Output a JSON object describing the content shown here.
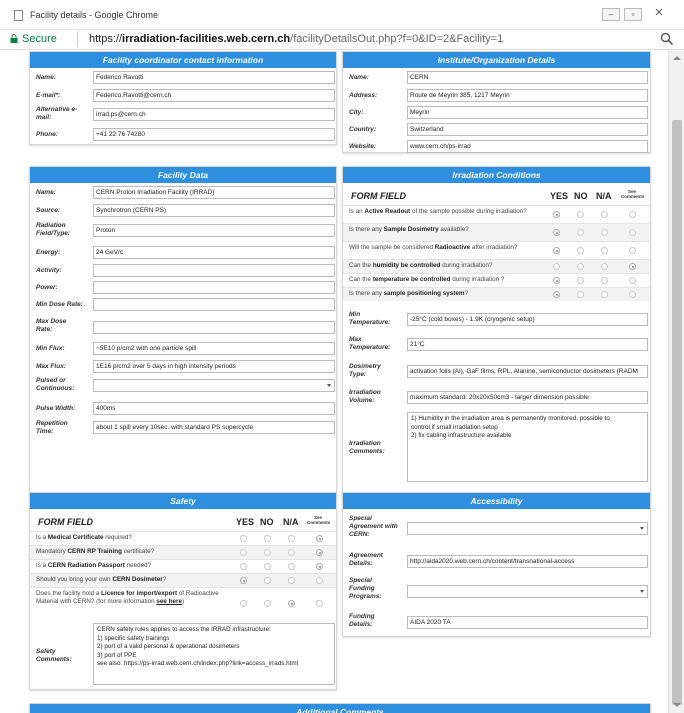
{
  "window": {
    "title": "Facility details - Google Chrome"
  },
  "address": {
    "secure_label": "Secure",
    "url_scheme": "https://",
    "url_domain": "irradiation-facilities.web.cern.ch",
    "url_path": "/facilityDetailsOut.php?f=0&ID=2&Facility=1"
  },
  "coordinator": {
    "title": "Facility coordinator contact information",
    "fields": [
      {
        "label": "Name:",
        "value": "Federico Ravotti"
      },
      {
        "label": "E-mail*:",
        "value": "Federico.Ravotti@cern.ch"
      },
      {
        "label": "Alternative e-mail:",
        "value": "irrad.ps@cern.ch"
      },
      {
        "label": "Phone:",
        "value": "+41 22 76 74280"
      }
    ]
  },
  "institute": {
    "title": "Institute/Organization Details",
    "fields": [
      {
        "label": "Name:",
        "value": "CERN"
      },
      {
        "label": "Address:",
        "value": "Route de Meyrin 385, 1217 Meyrin"
      },
      {
        "label": "City:",
        "value": "Meyrin"
      },
      {
        "label": "Country:",
        "value": "Switzerland"
      },
      {
        "label": "Website:",
        "value": "www.cern.ch/ps-irrad"
      }
    ]
  },
  "facility": {
    "title": "Facility Data",
    "fields": [
      {
        "label": "Name:",
        "value": "CERN Proton Irradiation Facility (IRRAD)"
      },
      {
        "label": "Source:",
        "value": "Synchrotron (CERN PS)"
      },
      {
        "label": "Radiation Field/Type:",
        "value": "Proton"
      },
      {
        "label": "Energy:",
        "value": "24 GeV/c"
      },
      {
        "label": "Activity:",
        "value": ""
      },
      {
        "label": "Power:",
        "value": ""
      },
      {
        "label": "Min Dose Rate:",
        "value": ""
      },
      {
        "label": "Max Dose Rate:",
        "value": ""
      },
      {
        "label": "Min Flux:",
        "value": "~5E10 p/cm2 with one particle spill"
      },
      {
        "label": "Max Flux:",
        "value": "1E16 p/cm2 over 5 days in high intensity periods"
      },
      {
        "label": "Pulsed or Continuous:",
        "value": ""
      },
      {
        "label": "Pulse Width:",
        "value": "400ms"
      },
      {
        "label": "Repetition Time:",
        "value": "about 1 spill every 10sec. with standard PS supercycle"
      }
    ]
  },
  "irradiation": {
    "title": "Irradiation Conditions",
    "form_field": "FORM FIELD",
    "col_yes": "YES",
    "col_no": "NO",
    "col_na": "N/A",
    "col_see": "See Comments",
    "questions": [
      {
        "pre": "Is an ",
        "bold": "Active Readout",
        "post": " of the sample possible during irradiation?",
        "sel": 0
      },
      {
        "pre": "Is there any ",
        "bold": "Sample Dosimetry",
        "post": " available?",
        "sel": 0
      },
      {
        "pre": "Will the sample be considered ",
        "bold": "Radioactive",
        "post": " after irradiation?",
        "sel": 0
      },
      {
        "pre": "Can the ",
        "bold": "humidity be controlled",
        "post": " during irradiation?",
        "sel": 3
      },
      {
        "pre": "Can the ",
        "bold": "temperature be controlled",
        "post": " during irradiation ?",
        "sel": 0
      },
      {
        "pre": "Is there any ",
        "bold": "sample positioning system",
        "post": "?",
        "sel": 0
      }
    ],
    "fields": [
      {
        "label": "Min Temperature:",
        "value": "-25°C (cold boxes) - 1.9K (cryogenic setup)"
      },
      {
        "label": "Max Temperature:",
        "value": "21°C"
      },
      {
        "label": "Dosimetry Type:",
        "value": "activation foils (Al), GaF films, RPL, Alanine, semiconductor dosimeters (RADM"
      },
      {
        "label": "Irradiation Volume:",
        "value": "maximum standard: 20x20x50cm3 - larger dimension possible"
      }
    ],
    "comments_label": "Irradiation Comments:",
    "comments": [
      "1) Humidity in the irradiation area is permanently monitored, possible to",
      "control if small irradiation setup",
      "2) fix cabling infrastructure available"
    ]
  },
  "safety": {
    "title": "Safety",
    "form_field": "FORM FIELD",
    "col_yes": "YES",
    "col_no": "NO",
    "col_na": "N/A",
    "col_see": "See Comments",
    "questions": [
      {
        "pre": "Is a ",
        "bold": "Medical Certificate",
        "post": " required?",
        "sel": 3
      },
      {
        "pre": "Mandatory ",
        "bold": "CERN RP Training",
        "post": " certificate?",
        "sel": 3
      },
      {
        "pre": "Is a ",
        "bold": "CERN Radiation Passport",
        "post": " needed?",
        "sel": 3
      },
      {
        "pre": "Should you bring your own ",
        "bold": "CERN Dosimeter",
        "post": "?",
        "sel": 0
      },
      {
        "pre": "Does the facility hold a ",
        "bold": "Licence for import/export",
        "post": " of Radioactive Material with CERN? (for more information ",
        "link": "see here",
        "tail": ")",
        "sel": 2
      }
    ],
    "comments_label": "Safety Comments:",
    "comments": [
      "CERN safety rules applies to access the IRRAD infrastructure:",
      "1) specific safety trainings",
      "2) port of a valid personal & operational dosimeters",
      "3) port of PPE",
      "see also:  https://ps-irrad.web.cern.ch/index.php?link=access_irrads.html"
    ]
  },
  "accessibility": {
    "title": "Accessibility",
    "fields": [
      {
        "label": "Special Agreement with CERN:",
        "value": ""
      },
      {
        "label": "Agreement Details:",
        "value": "http://aida2020.web.cern.ch/content/transnational-access"
      },
      {
        "label": "Special Funding Programs:",
        "value": ""
      },
      {
        "label": "Funding Details:",
        "value": "AIDA 2020 TA"
      }
    ]
  },
  "additional": {
    "title": "Additional Comments"
  }
}
